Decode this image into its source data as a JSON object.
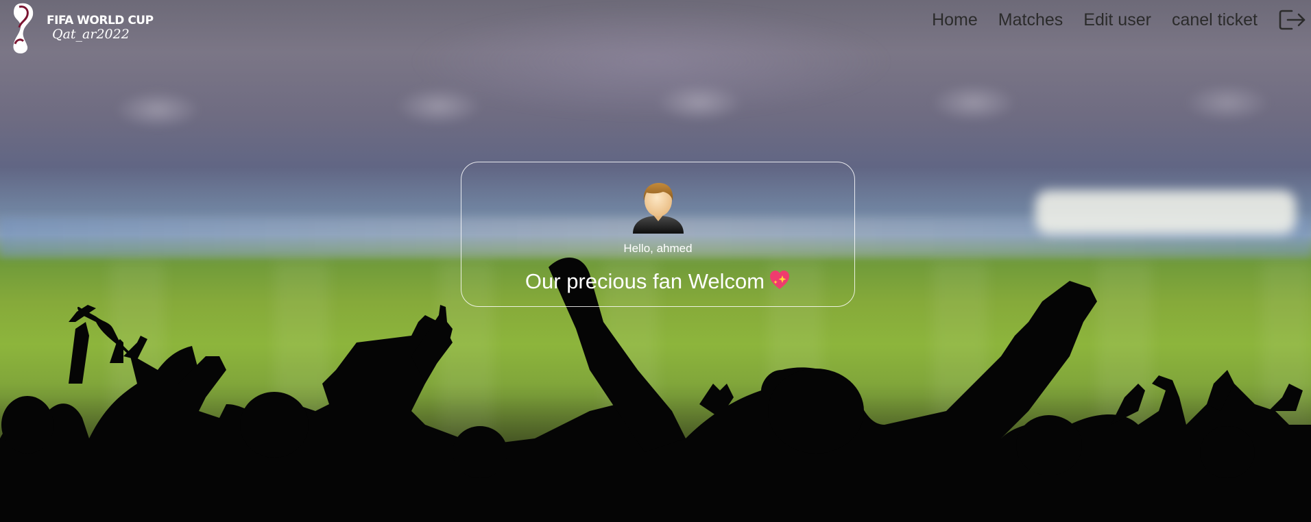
{
  "brand": {
    "line1": "FIFA WORLD CUP",
    "line2": "Qat_ar2022"
  },
  "nav": {
    "items": [
      {
        "label": "Home"
      },
      {
        "label": "Matches"
      },
      {
        "label": "Edit user"
      },
      {
        "label": "canel ticket"
      }
    ],
    "logout_icon": "logout-icon"
  },
  "card": {
    "avatar_icon": "user-avatar-icon",
    "greeting": "Hello, ahmed",
    "welcome_text": "Our precious fan Welcom",
    "heart_icon": "sparkling-heart-icon"
  },
  "colors": {
    "nav_text": "#2b2b2b",
    "card_border": "#ffffff",
    "text_light": "#ffffff"
  }
}
